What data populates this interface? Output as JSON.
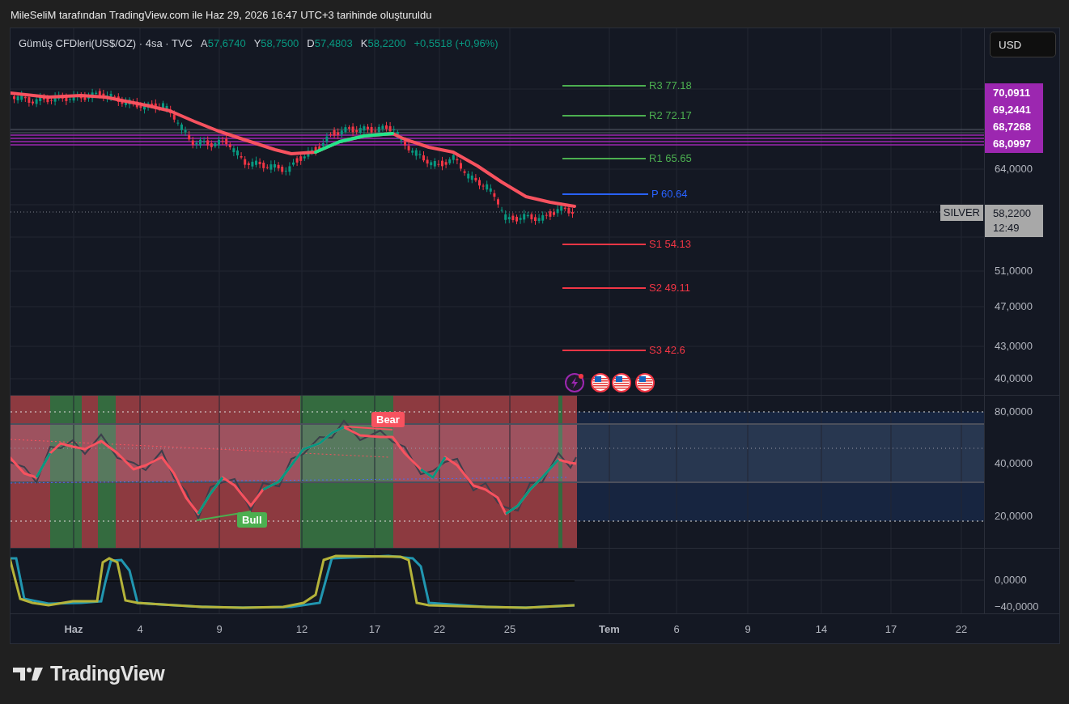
{
  "attribution": "MileSeliM tarafından TradingView.com ile Haz 29, 2026 16:47 UTC+3 tarihinde oluşturuldu",
  "legend": {
    "symbol": "Gümüş CFDleri(US$/OZ) · 4sa · TVC",
    "ohlc": [
      {
        "key": "A",
        "value": "57,6740"
      },
      {
        "key": "Y",
        "value": "58,7500"
      },
      {
        "key": "D",
        "value": "57,4803"
      },
      {
        "key": "K",
        "value": "58,2200"
      }
    ],
    "change": "+0,5518 (+0,96%)"
  },
  "currency_button": "USD",
  "pivots": [
    {
      "text": "R3 77.18",
      "kind": "resistance"
    },
    {
      "text": "R2 72.17",
      "kind": "resistance"
    },
    {
      "text": "R1 65.65",
      "kind": "resistance"
    },
    {
      "text": "P 60.64",
      "kind": "pivot"
    },
    {
      "text": "S1 54.13",
      "kind": "support"
    },
    {
      "text": "S2 49.11",
      "kind": "support"
    },
    {
      "text": "S3 42.6",
      "kind": "support"
    }
  ],
  "price_axis": {
    "labels": [
      "64,0000",
      "51,0000",
      "47,0000",
      "43,0000",
      "40,0000"
    ],
    "highlighted": [
      "70,0911",
      "69,2441",
      "68,7268",
      "68,0997"
    ],
    "last_price": {
      "symbol": "SILVER",
      "price": "58,2200",
      "countdown": "12:49"
    }
  },
  "rsi_pane": {
    "bear_label": "Bear",
    "bull_label": "Bull",
    "axis": [
      "80,0000",
      "40,0000",
      "20,0000"
    ]
  },
  "oscillator_pane": {
    "axis": [
      "0,0000",
      "−40,0000"
    ]
  },
  "time_axis": [
    {
      "text": "Haz",
      "kind": "month"
    },
    {
      "text": "4",
      "kind": "day"
    },
    {
      "text": "9",
      "kind": "day"
    },
    {
      "text": "12",
      "kind": "day"
    },
    {
      "text": "17",
      "kind": "day"
    },
    {
      "text": "22",
      "kind": "day"
    },
    {
      "text": "25",
      "kind": "day"
    },
    {
      "text": "Tem",
      "kind": "month"
    },
    {
      "text": "6",
      "kind": "day"
    },
    {
      "text": "9",
      "kind": "day"
    },
    {
      "text": "14",
      "kind": "day"
    },
    {
      "text": "17",
      "kind": "day"
    },
    {
      "text": "22",
      "kind": "day"
    }
  ],
  "footer": {
    "brand": "TradingView"
  }
}
